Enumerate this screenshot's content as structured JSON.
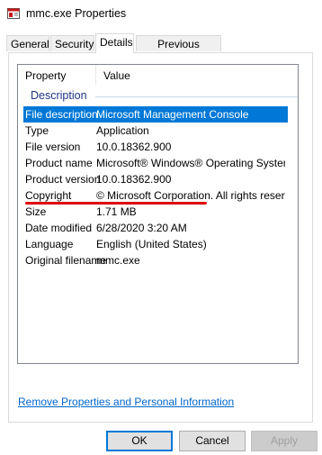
{
  "window": {
    "title": "mmc.exe Properties"
  },
  "tabs": [
    {
      "label": "General",
      "active": false
    },
    {
      "label": "Security",
      "active": false
    },
    {
      "label": "Details",
      "active": true
    },
    {
      "label": "Previous Versions",
      "active": false
    }
  ],
  "details": {
    "columns": {
      "property": "Property",
      "value": "Value"
    },
    "group": "Description",
    "rows": [
      {
        "key": "File description",
        "value": "Microsoft Management Console",
        "selected": true
      },
      {
        "key": "Type",
        "value": "Application"
      },
      {
        "key": "File version",
        "value": "10.0.18362.900"
      },
      {
        "key": "Product name",
        "value": "Microsoft® Windows® Operating System"
      },
      {
        "key": "Product version",
        "value": "10.0.18362.900"
      },
      {
        "key": "Copyright",
        "value": "© Microsoft Corporation. All rights reserv..."
      },
      {
        "key": "Size",
        "value": "1.71 MB"
      },
      {
        "key": "Date modified",
        "value": "6/28/2020 3:20 AM"
      },
      {
        "key": "Language",
        "value": "English (United States)"
      },
      {
        "key": "Original filename",
        "value": "mmc.exe"
      }
    ]
  },
  "link": {
    "label": "Remove Properties and Personal Information"
  },
  "buttons": {
    "ok": "OK",
    "cancel": "Cancel",
    "apply": "Apply"
  },
  "colors": {
    "selection": "#0078d7",
    "link": "#0066cc",
    "annotation": "#e00000",
    "group": "#1e3287"
  }
}
